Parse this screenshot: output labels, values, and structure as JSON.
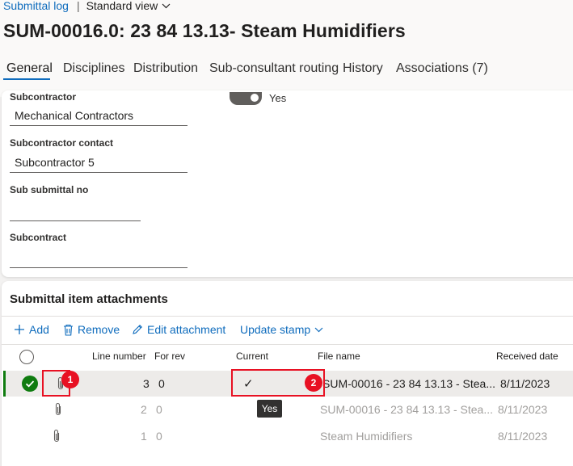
{
  "breadcrumb": {
    "link": "Submittal log",
    "separator": "|",
    "view": "Standard view"
  },
  "page_title": "SUM-00016.0: 23 84 13.13- Steam Humidifiers",
  "tabs": [
    "General",
    "Disciplines",
    "Distribution",
    "Sub-consultant routing",
    "History",
    "Associations (7)"
  ],
  "form": {
    "subcontractor_label": "Subcontractor",
    "subcontractor_value": "Mechanical Contractors",
    "toggle_value": "Yes",
    "contact_label": "Subcontractor contact",
    "contact_value": "Subcontractor 5",
    "sub_submittal_label": "Sub submittal no",
    "sub_submittal_value": "",
    "subcontract_label": "Subcontract",
    "subcontract_value": ""
  },
  "attachments": {
    "title": "Submittal item attachments",
    "toolbar": {
      "add": "Add",
      "remove": "Remove",
      "edit": "Edit attachment",
      "update": "Update stamp"
    },
    "columns": {
      "line": "Line number",
      "rev": "For rev",
      "current": "Current",
      "file": "File name",
      "received": "Received date"
    },
    "rows": [
      {
        "line": "3",
        "rev": "0",
        "current": "✓",
        "file": "SUM-00016 - 23 84 13.13 - Stea...",
        "received": "8/11/2023"
      },
      {
        "line": "2",
        "rev": "0",
        "current": "",
        "file": "SUM-00016 - 23 84 13.13 - Stea...",
        "received": "8/11/2023"
      },
      {
        "line": "1",
        "rev": "0",
        "current": "",
        "file": "Steam Humidifiers",
        "received": "8/11/2023"
      }
    ],
    "tooltip": "Yes"
  },
  "annotations": [
    "1",
    "2"
  ],
  "colors": {
    "accent": "#0f6cbd",
    "success": "#107c10",
    "annotation": "#e81123"
  }
}
